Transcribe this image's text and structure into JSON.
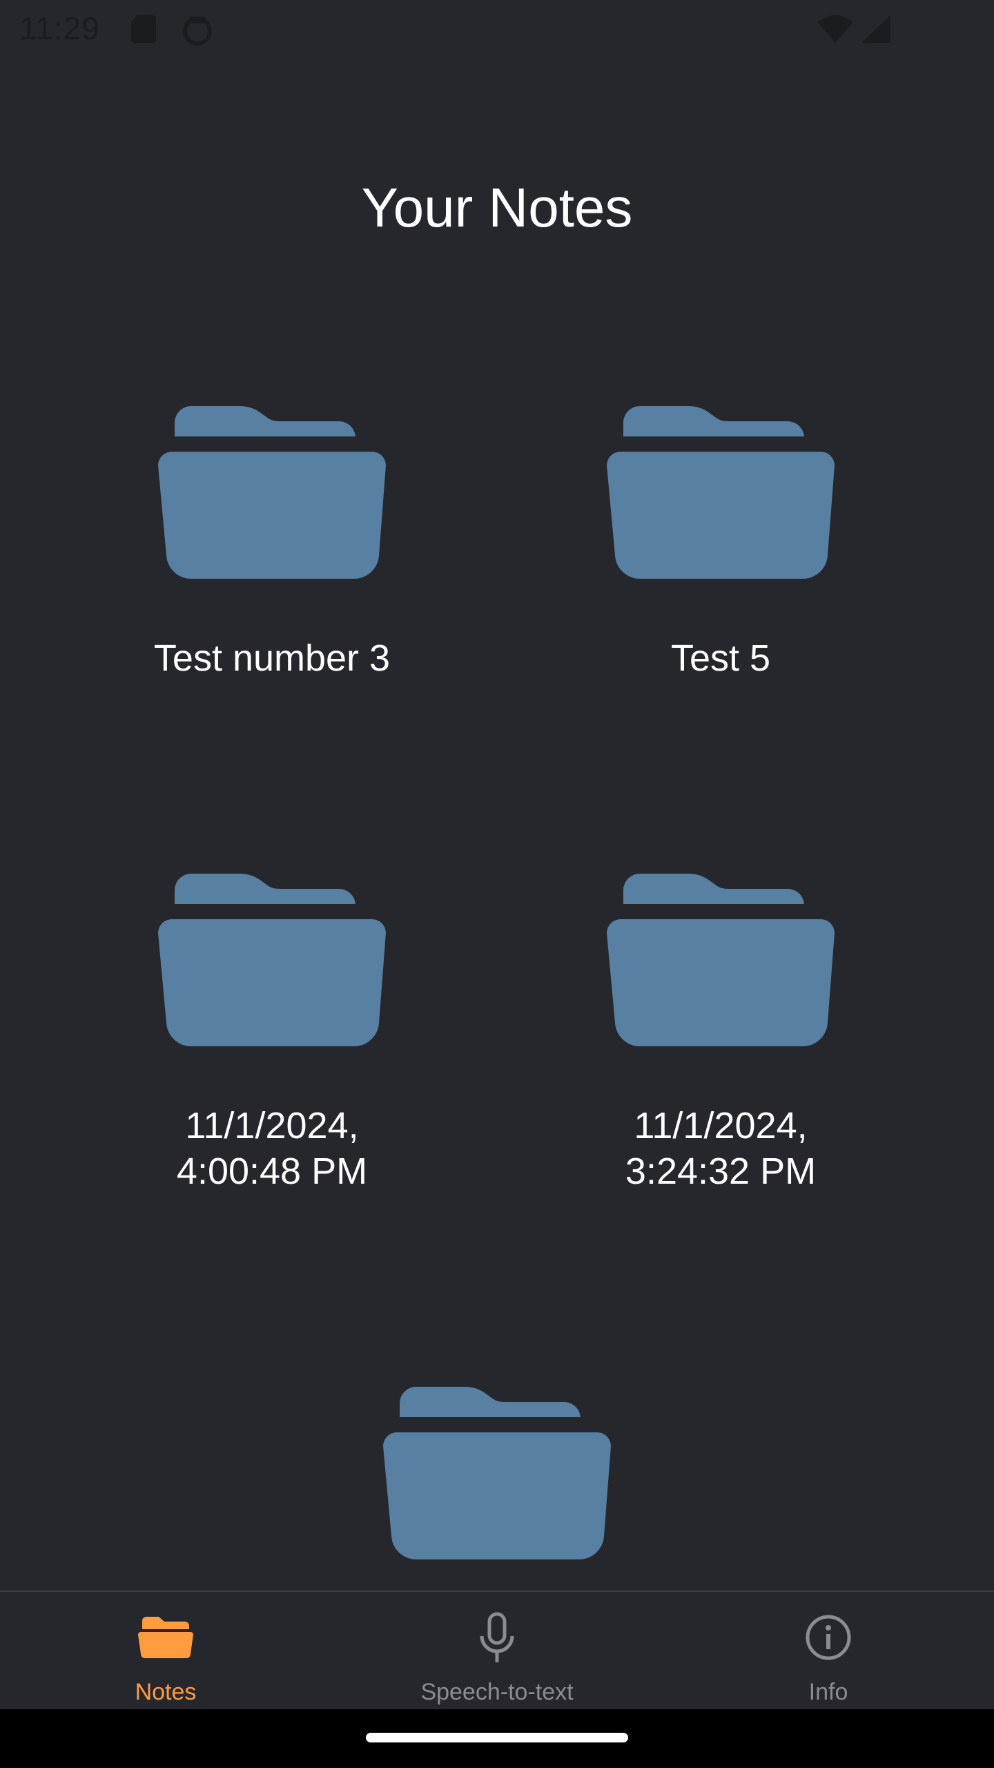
{
  "status_bar": {
    "time": "11:29"
  },
  "page": {
    "title": "Your Notes"
  },
  "colors": {
    "background": "#25272d",
    "folder": "#5880a2",
    "accent": "#ff9c40",
    "inactive": "#8a8c91"
  },
  "notes": [
    {
      "label": "Test number 3",
      "icon": "folder-icon"
    },
    {
      "label": "Test 5",
      "icon": "folder-icon"
    },
    {
      "label": "11/1/2024,\n4:00:48 PM",
      "icon": "folder-icon"
    },
    {
      "label": "11/1/2024,\n3:24:32 PM",
      "icon": "folder-icon"
    },
    {
      "label": "",
      "icon": "folder-icon"
    }
  ],
  "bottom_nav": {
    "items": [
      {
        "label": "Notes",
        "icon": "folder-open-icon",
        "active": true
      },
      {
        "label": "Speech-to-text",
        "icon": "microphone-icon",
        "active": false
      },
      {
        "label": "Info",
        "icon": "info-icon",
        "active": false
      }
    ]
  }
}
